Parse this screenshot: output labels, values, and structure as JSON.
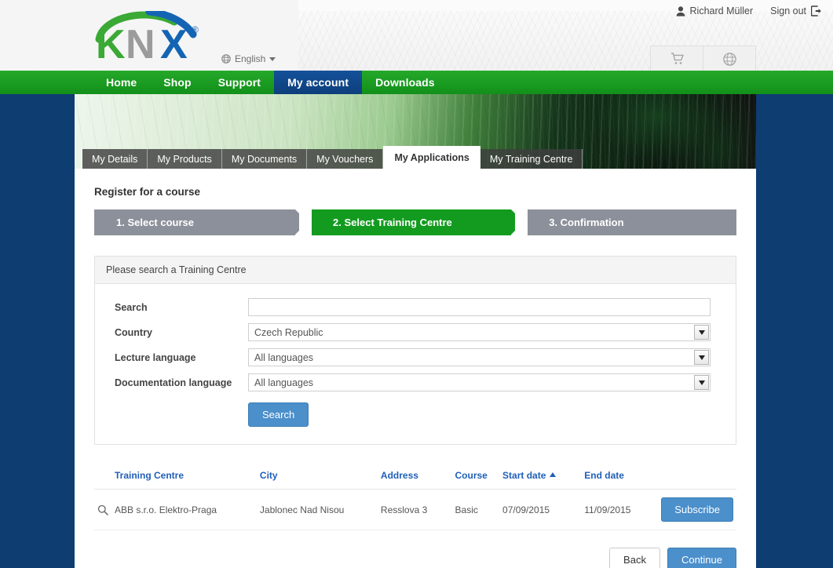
{
  "header": {
    "user_name": "Richard Müller",
    "user_icon": "user-icon",
    "sign_out_label": "Sign out",
    "sign_out_icon": "sign-out-icon",
    "logo_text": "KNX",
    "logo_trademark": "®",
    "language_label": "English",
    "language_icon": "globe-icon",
    "cart_icon": "cart-icon",
    "globe_icon": "globe-icon",
    "colors": {
      "nav_green": "#12901a",
      "nav_active_blue": "#0d3e7b",
      "page_blue": "#0e3d72",
      "accent_blue": "#4b8fcb",
      "link_blue": "#1f5fb8",
      "step_green": "#139b1f",
      "step_grey": "#8c909a"
    }
  },
  "nav": {
    "items": [
      {
        "label": "Home",
        "active": false
      },
      {
        "label": "Shop",
        "active": false
      },
      {
        "label": "Support",
        "active": false
      },
      {
        "label": "My account",
        "active": true
      },
      {
        "label": "Downloads",
        "active": false
      }
    ]
  },
  "tabs": [
    {
      "label": "My Details",
      "active": false
    },
    {
      "label": "My Products",
      "active": false
    },
    {
      "label": "My Documents",
      "active": false
    },
    {
      "label": "My Vouchers",
      "active": false
    },
    {
      "label": "My Applications",
      "active": true
    },
    {
      "label": "My Training Centre",
      "active": false
    }
  ],
  "main": {
    "page_title": "Register for a course",
    "steps": [
      {
        "label": "1. Select course",
        "state": "inactive"
      },
      {
        "label": "2. Select Training Centre",
        "state": "active"
      },
      {
        "label": "3. Confirmation",
        "state": "inactive"
      }
    ],
    "search_panel": {
      "heading": "Please search a Training Centre",
      "fields": {
        "search": {
          "label": "Search",
          "value": "",
          "placeholder": ""
        },
        "country": {
          "label": "Country",
          "value": "Czech Republic"
        },
        "lecture_language": {
          "label": "Lecture language",
          "value": "All languages"
        },
        "documentation_language": {
          "label": "Documentation language",
          "value": "All languages"
        }
      },
      "search_button": "Search"
    },
    "results": {
      "columns": [
        {
          "label": "Training Centre",
          "sorted": false
        },
        {
          "label": "City",
          "sorted": false
        },
        {
          "label": "Address",
          "sorted": false
        },
        {
          "label": "Course",
          "sorted": false
        },
        {
          "label": "Start date",
          "sorted": true,
          "direction": "asc"
        },
        {
          "label": "End date",
          "sorted": false
        }
      ],
      "rows": [
        {
          "training_centre": "ABB s.r.o. Elektro-Praga",
          "city": "Jablonec Nad Nisou",
          "address": "Resslova 3",
          "course": "Basic",
          "start_date": "07/09/2015",
          "end_date": "11/09/2015",
          "action_label": "Subscribe",
          "row_icon": "magnifier-icon"
        }
      ]
    },
    "footer": {
      "back_label": "Back",
      "continue_label": "Continue"
    }
  }
}
